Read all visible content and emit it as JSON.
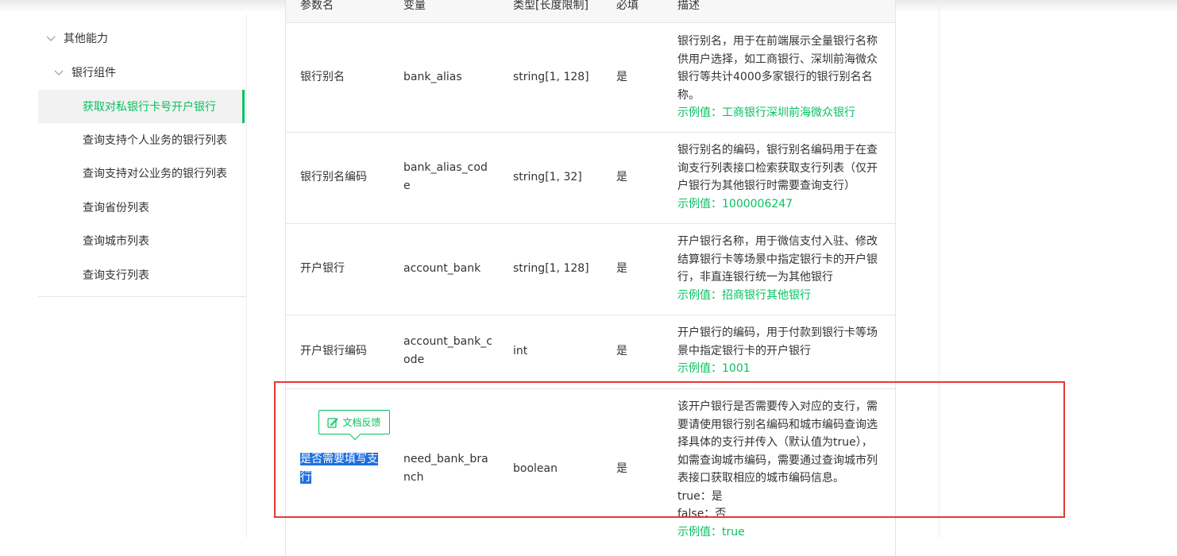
{
  "sidebar": {
    "group": "其他能力",
    "subgroup": "银行组件",
    "items": [
      {
        "label": "获取对私银行卡号开户银行",
        "active": true
      },
      {
        "label": "查询支持个人业务的银行列表"
      },
      {
        "label": "查询支持对公业务的银行列表"
      },
      {
        "label": "查询省份列表"
      },
      {
        "label": "查询城市列表"
      },
      {
        "label": "查询支行列表"
      }
    ]
  },
  "table": {
    "headers": [
      "参数名",
      "变量",
      "类型[长度限制]",
      "必填",
      "描述"
    ],
    "rows": [
      {
        "name": "银行别名",
        "var": "bank_alias",
        "type": "string[1, 128]",
        "required": "是",
        "desc": "银行别名，用于在前端展示全量银行名称供用户选择，如工商银行、深圳前海微众银行等共计4000多家银行的银行别名名称。",
        "example": "示例值：工商银行深圳前海微众银行"
      },
      {
        "name": "银行别名编码",
        "var": "bank_alias_code",
        "type": "string[1, 32]",
        "required": "是",
        "desc": "银行别名的编码，银行别名编码用于在查询支行列表接口检索获取支行列表（仅开户银行为其他银行时需要查询支行）",
        "example": "示例值：1000006247"
      },
      {
        "name": "开户银行",
        "var": "account_bank",
        "type": "string[1, 128]",
        "required": "是",
        "desc": "开户银行名称，用于微信支付入驻、修改结算银行卡等场景中指定银行卡的开户银行，非直连银行统一为其他银行",
        "example": "示例值：招商银行其他银行"
      },
      {
        "name": "开户银行编码",
        "var": "account_bank_code",
        "type": "int",
        "required": "是",
        "desc": "开户银行的编码，用于付款到银行卡等场景中指定银行卡的开户银行",
        "example": "示例值：1001"
      },
      {
        "name": "是否需要填写支行",
        "var": "need_bank_branch",
        "type": "boolean",
        "required": "是",
        "desc": "该开户银行是否需要传入对应的支行，需要请使用银行别名编码和城市编码查询选择具体的支行并传入（默认值为true），如需查询城市编码，需要通过查询城市列表接口获取相应的城市编码信息。",
        "desc_true": "true：是",
        "desc_false": "false：否",
        "example": "示例值：true"
      }
    ]
  },
  "feedback": {
    "label": "文档反馈",
    "icon": "edit-icon"
  },
  "colors": {
    "accent": "#07c160",
    "selection": "#1e6fe0",
    "highlight": "#e53935"
  }
}
